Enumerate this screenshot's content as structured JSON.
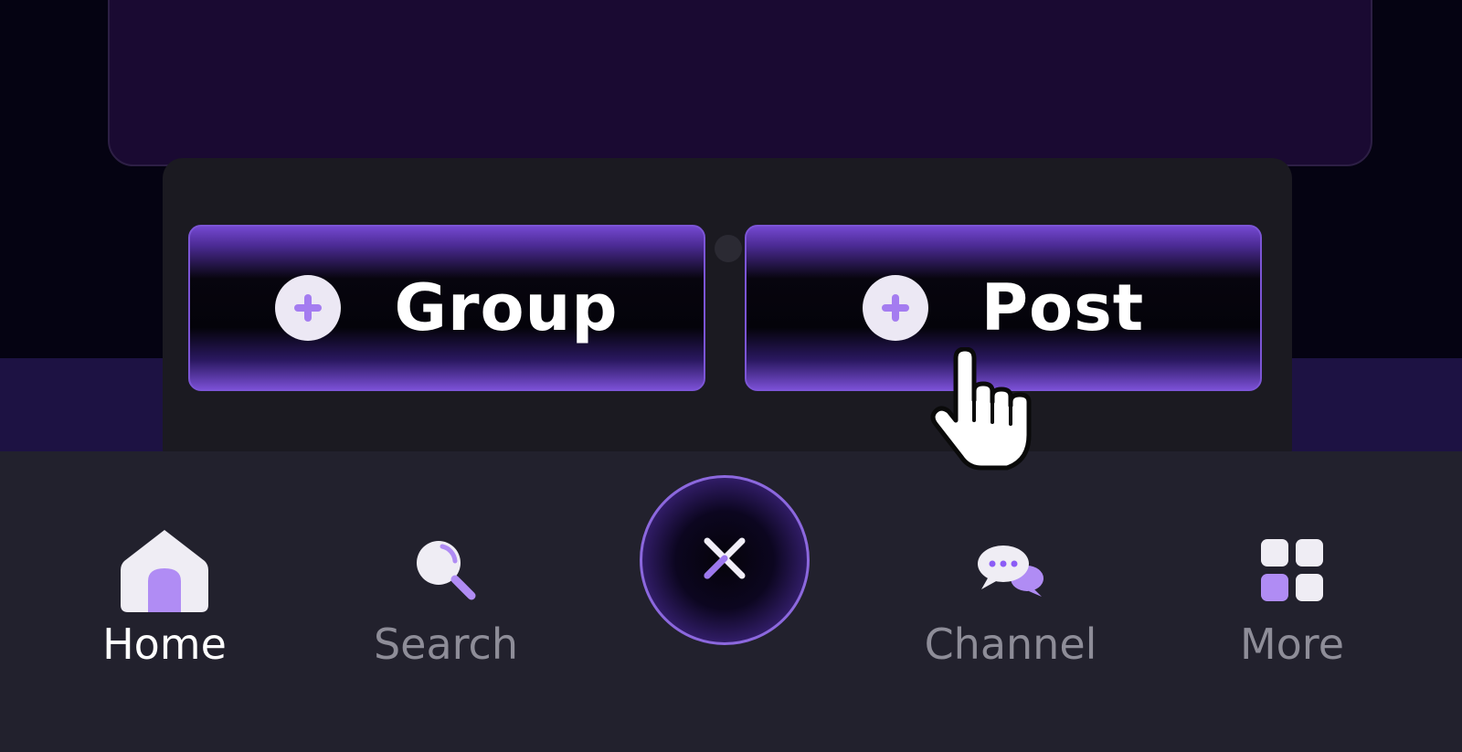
{
  "popup": {
    "actions": [
      {
        "label": "Group",
        "icon": "plus-circle-icon"
      },
      {
        "label": "Post",
        "icon": "plus-circle-icon"
      }
    ]
  },
  "fab": {
    "icon": "close-icon"
  },
  "nav": {
    "items": [
      {
        "label": "Home",
        "icon": "home-icon",
        "active": true
      },
      {
        "label": "Search",
        "icon": "search-icon",
        "active": false
      },
      {
        "label": "Channel",
        "icon": "chat-bubbles-icon",
        "active": false
      },
      {
        "label": "More",
        "icon": "grid-icon",
        "active": false
      }
    ]
  },
  "colors": {
    "accent": "#8b5cf6",
    "accent_light": "#b79cf5",
    "background": "#050312",
    "nav_background": "#22212d",
    "popup_background": "#1b1a21",
    "inactive_label": "#8e8d98"
  }
}
